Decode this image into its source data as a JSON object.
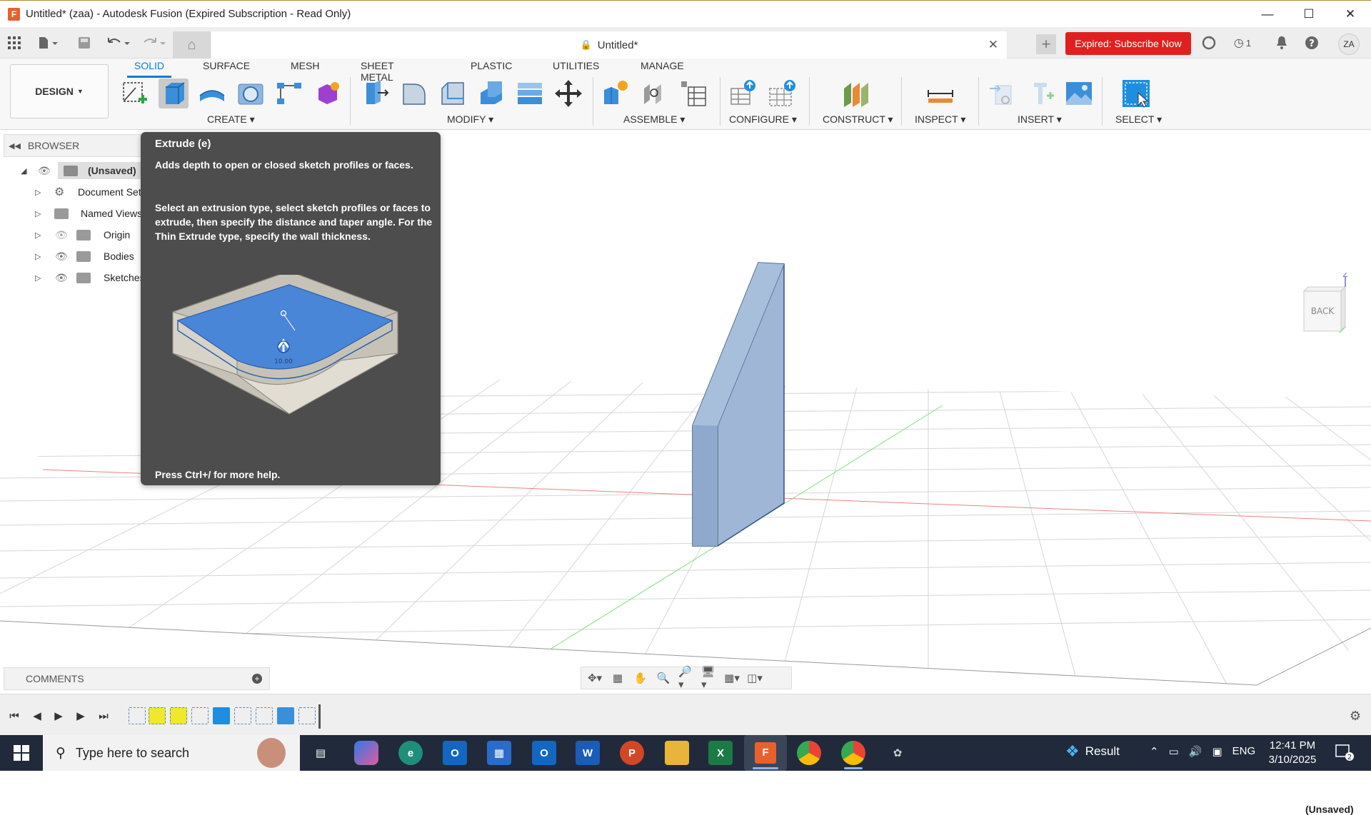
{
  "window": {
    "title": "Untitled* (zaa) - Autodesk Fusion (Expired Subscription - Read Only)",
    "app_icon": "F",
    "controls": [
      "minimize-icon",
      "maximize-icon",
      "close-icon"
    ]
  },
  "docbar": {
    "tab_title": "Untitled*",
    "subscribe_label": "Expired: Subscribe Now",
    "job_count": "1",
    "avatar_initials": "ZA"
  },
  "ribbon": {
    "workspace": "DESIGN",
    "tabs": [
      "SOLID",
      "SURFACE",
      "MESH",
      "SHEET METAL",
      "PLASTIC",
      "UTILITIES",
      "MANAGE"
    ],
    "active_tab": "SOLID",
    "groups": [
      "CREATE",
      "MODIFY",
      "ASSEMBLE",
      "CONFIGURE",
      "CONSTRUCT",
      "INSPECT",
      "INSERT",
      "SELECT"
    ]
  },
  "browser": {
    "header": "BROWSER",
    "items": [
      {
        "label": "(Unsaved)",
        "type": "root"
      },
      {
        "label": "Document Settings",
        "type": "settings"
      },
      {
        "label": "Named Views",
        "type": "folder"
      },
      {
        "label": "Origin",
        "type": "folder",
        "hidden": true
      },
      {
        "label": "Bodies",
        "type": "folder"
      },
      {
        "label": "Sketches",
        "type": "folder"
      }
    ]
  },
  "tooltip": {
    "title": "Extrude (e)",
    "description": "Adds depth to open or closed sketch profiles or faces.",
    "detail": "Select an extrusion type, select sketch profiles or faces to extrude, then specify the distance and taper angle. For the Thin Extrude type, specify the wall thickness.",
    "image_value": "10.00",
    "footer": "Press Ctrl+/ for more help."
  },
  "viewport": {
    "viewcube_label": "BACK",
    "axis_label": "Z",
    "status": "(Unsaved)"
  },
  "comments": {
    "label": "COMMENTS"
  },
  "taskbar": {
    "search_placeholder": "Type here to search",
    "weather_label": "Result",
    "language": "ENG",
    "time": "12:41 PM",
    "date": "3/10/2025",
    "notification_count": "2"
  },
  "colors": {
    "accent": "#0a7cd6",
    "subscribe": "#e02020",
    "tooltip_bg": "#4d4d4d",
    "body_fill": "#9fb6d6",
    "taskbar": "#202a3a"
  }
}
